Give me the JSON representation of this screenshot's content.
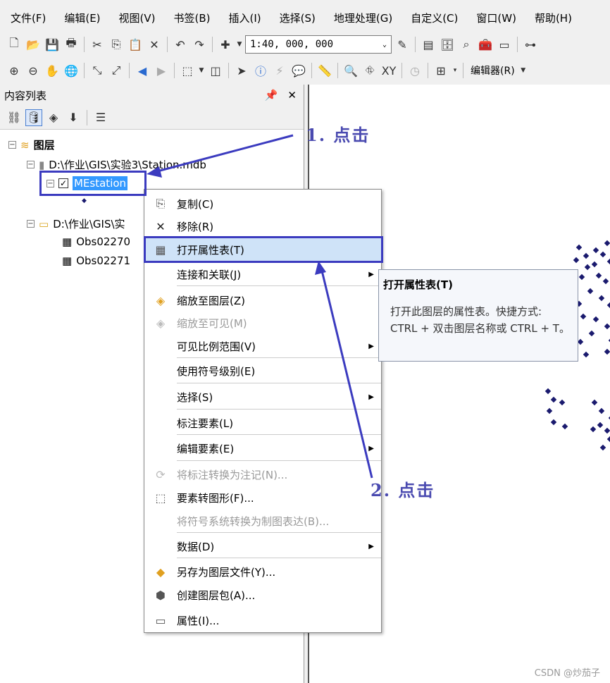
{
  "menubar": [
    "文件(F)",
    "编辑(E)",
    "视图(V)",
    "书签(B)",
    "插入(I)",
    "选择(S)",
    "地理处理(G)",
    "自定义(C)",
    "窗口(W)",
    "帮助(H)"
  ],
  "toolbar": {
    "scale": "1:40, 000, 000",
    "editor": "编辑器(R)"
  },
  "toc": {
    "title": "内容列表",
    "pin": "ᵖ",
    "close": "✕",
    "root": "图层",
    "db_path": "D:\\作业\\GIS\\实验3\\Station.mdb",
    "layer": "MEstation",
    "folder_path": "D:\\作业\\GIS\\实",
    "tables": [
      "Obs02270",
      "Obs02271"
    ]
  },
  "context_menu": {
    "items": [
      {
        "label": "复制(C)",
        "icon": "copy-icon",
        "enabled": true
      },
      {
        "label": "移除(R)",
        "icon": "remove-icon",
        "enabled": true
      },
      {
        "label": "打开属性表(T)",
        "icon": "table-icon",
        "enabled": true,
        "highlighted": true
      },
      {
        "label": "连接和关联(J)",
        "submenu": true,
        "enabled": true
      },
      {
        "label": "缩放至图层(Z)",
        "icon": "zoom-layer-icon",
        "enabled": true
      },
      {
        "label": "缩放至可见(M)",
        "icon": "zoom-visible-icon",
        "enabled": false
      },
      {
        "label": "可见比例范围(V)",
        "submenu": true,
        "enabled": true
      },
      {
        "label": "使用符号级别(E)",
        "enabled": true
      },
      {
        "label": "选择(S)",
        "submenu": true,
        "enabled": true
      },
      {
        "label": "标注要素(L)",
        "enabled": true
      },
      {
        "label": "编辑要素(E)",
        "submenu": true,
        "enabled": true
      },
      {
        "label": "将标注转换为注记(N)...",
        "icon": "convert-labels-icon",
        "enabled": false
      },
      {
        "label": "要素转图形(F)...",
        "icon": "features-to-graphics-icon",
        "enabled": true
      },
      {
        "label": "将符号系统转换为制图表达(B)...",
        "enabled": false
      },
      {
        "label": "数据(D)",
        "submenu": true,
        "enabled": true
      },
      {
        "label": "另存为图层文件(Y)...",
        "icon": "save-layer-icon",
        "enabled": true
      },
      {
        "label": "创建图层包(A)...",
        "icon": "layer-package-icon",
        "enabled": true
      },
      {
        "label": "属性(I)...",
        "icon": "properties-icon",
        "enabled": true
      }
    ]
  },
  "tooltip": {
    "title": "打开属性表(T)",
    "body": "打开此图层的属性表。快捷方式: CTRL + 双击图层名称或 CTRL + T。"
  },
  "annotations": {
    "step1": "1. 点击",
    "step2": "2. 点击"
  },
  "watermark": "CSDN @炒茄子",
  "colors": {
    "annotation": "#3b3bbf",
    "selection": "#3399ff",
    "map_points": "#1a1a6e"
  }
}
